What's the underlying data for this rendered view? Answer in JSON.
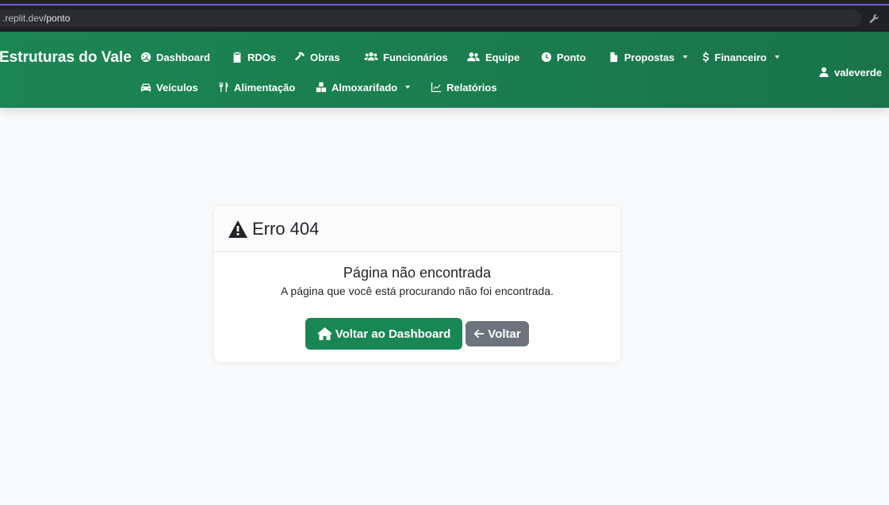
{
  "browser": {
    "url_host": ".replit.dev",
    "url_path": "/ponto"
  },
  "navbar": {
    "brand": "Estruturas do Vale",
    "items": [
      {
        "label": "Dashboard",
        "icon": "dashboard-icon"
      },
      {
        "label": "RDOs",
        "icon": "clipboard-icon"
      },
      {
        "label": "Obras",
        "icon": "hammer-icon"
      },
      {
        "label": "Funcionários",
        "icon": "users-icon"
      },
      {
        "label": "Equipe",
        "icon": "user-group-icon"
      },
      {
        "label": "Ponto",
        "icon": "clock-icon"
      },
      {
        "label": "Propostas",
        "icon": "file-icon",
        "dropdown": true
      },
      {
        "label": "Financeiro",
        "icon": "dollar-icon",
        "dropdown": true
      },
      {
        "label": "Veículos",
        "icon": "car-icon"
      },
      {
        "label": "Alimentação",
        "icon": "utensils-icon"
      },
      {
        "label": "Almoxarifado",
        "icon": "boxes-icon",
        "dropdown": true
      },
      {
        "label": "Relatórios",
        "icon": "chart-line-icon"
      }
    ],
    "user": {
      "label": "valeverde",
      "icon": "user-icon",
      "dropdown": true
    }
  },
  "error_card": {
    "title": "Erro 404",
    "heading": "Página não encontrada",
    "message": "A página que você está procurando não foi encontrada.",
    "primary_button": "Voltar ao Dashboard",
    "secondary_button": "Voltar"
  },
  "colors": {
    "navbar": "#198754",
    "primary_button": "#198754",
    "secondary_button": "#6c757d",
    "background": "#f8f9fa"
  }
}
